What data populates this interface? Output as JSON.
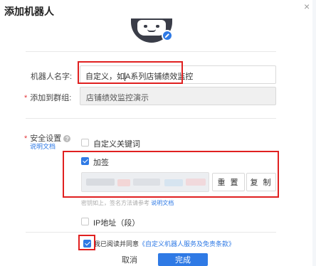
{
  "dialog": {
    "title": "添加机器人",
    "close_glyph": "×"
  },
  "avatar": {
    "edit_icon": "pencil-icon"
  },
  "form": {
    "name_label": "机器人名字:",
    "name_value_before": "自定义，如",
    "name_value_after": "A系列店铺绩效监控",
    "group_required": "*",
    "group_label": "添加到群组:",
    "group_value": "店铺绩效监控演示"
  },
  "security": {
    "required": "*",
    "label": "安全设置",
    "help_glyph": "?",
    "doc_link": "说明文档",
    "option_keyword": "自定义关键词",
    "option_sign": "加签",
    "reset_label": "重 置",
    "copy_label": "复 制",
    "hint_text": "密钥如上，签名方法请参考",
    "hint_link": "说明文档",
    "option_ip": "IP地址（段）"
  },
  "agreement": {
    "text": "我已阅读并同意",
    "link": "《自定义机器人服务及免责条款》"
  },
  "footer": {
    "cancel": "取消",
    "done": "完成"
  },
  "colors": {
    "accent": "#2f7ae5",
    "highlight": "#e02020"
  }
}
